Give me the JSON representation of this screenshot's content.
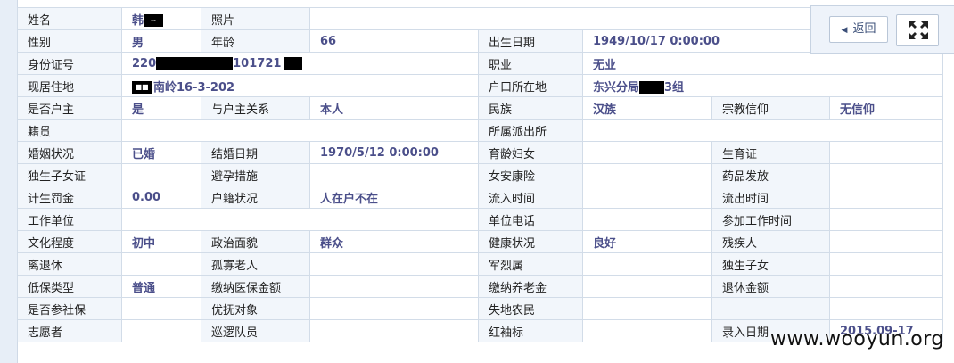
{
  "toolbar": {
    "back_label": "返回",
    "back_icon": "triangle-left-icon",
    "fullscreen_icon": "fullscreen-icon"
  },
  "watermark": "www.wooyun.org",
  "fields": {
    "name_label": "姓名",
    "name_value": "韩",
    "photo_label": "照片",
    "gender_label": "性别",
    "gender_value": "男",
    "age_label": "年龄",
    "age_value": "66",
    "birth_label": "出生日期",
    "birth_value": "1949/10/17 0:00:00",
    "id_label": "身份证号",
    "id_value_a": "220",
    "id_value_b": "101721",
    "job_label": "职业",
    "job_value": "无业",
    "addr_label": "现居住地",
    "addr_value": "南岭16-3-202",
    "hukou_label": "户口所在地",
    "hukou_value_a": "东兴分局",
    "hukou_value_b": "3组",
    "head_label": "是否户主",
    "head_value": "是",
    "relation_label": "与户主关系",
    "relation_value": "本人",
    "ethnic_label": "民族",
    "ethnic_value": "汉族",
    "religion_label": "宗教信仰",
    "religion_value": "无信仰",
    "native_label": "籍贯",
    "police_label": "所属派出所",
    "marital_label": "婚姻状况",
    "marital_value": "已婚",
    "wedding_label": "结婚日期",
    "wedding_value": "1970/5/12 0:00:00",
    "childbearing_label": "育龄妇女",
    "birthcert_label": "生育证",
    "onlychild_label": "独生子女证",
    "contraception_label": "避孕措施",
    "womenins_label": "女安康险",
    "medicine_label": "药品发放",
    "fine_label": "计生罚金",
    "fine_value": "0.00",
    "hjstatus_label": "户籍状况",
    "hjstatus_value": "人在户不在",
    "inflow_label": "流入时间",
    "outflow_label": "流出时间",
    "workunit_label": "工作单位",
    "unitphone_label": "单位电话",
    "worktime_label": "参加工作时间",
    "edu_label": "文化程度",
    "edu_value": "初中",
    "political_label": "政治面貌",
    "political_value": "群众",
    "health_label": "健康状况",
    "health_value": "良好",
    "disabled_label": "残疾人",
    "retired_label": "离退休",
    "lonely_label": "孤寡老人",
    "martyr_label": "军烈属",
    "onlychild2_label": "独生子女",
    "dibao_label": "低保类型",
    "dibao_value": "普通",
    "medins_label": "缴纳医保金额",
    "pension_label": "缴纳养老金",
    "retirepay_label": "退休金额",
    "social_label": "是否参社保",
    "preferential_label": "优抚对象",
    "landless_label": "失地农民",
    "volunteer_label": "志愿者",
    "patrol_label": "巡逻队员",
    "redband_label": "红袖标",
    "entrydate_label": "录入日期",
    "entrydate_value": "2015.09-17"
  },
  "redactions": {
    "name_mark": "--",
    "addr_mark": "■■"
  }
}
